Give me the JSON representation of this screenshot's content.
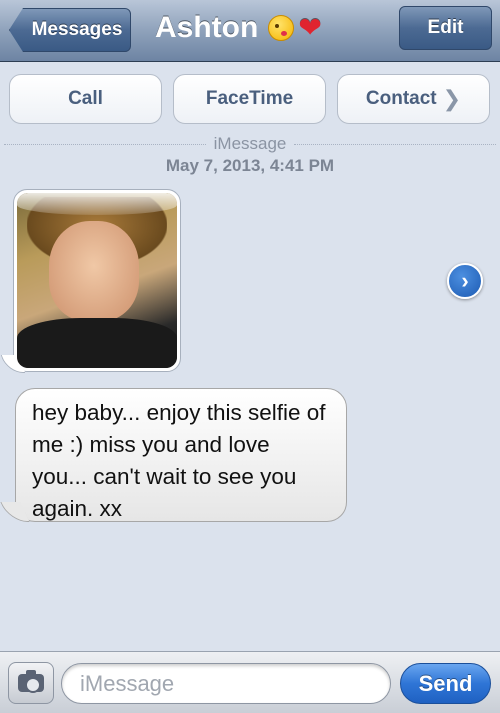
{
  "navbar": {
    "back_label": "Messages",
    "title": "Ashton",
    "edit_label": "Edit",
    "title_emojis": [
      "kiss-emoji",
      "heart-icon"
    ]
  },
  "actions": {
    "call": "Call",
    "facetime": "FaceTime",
    "contact": "Contact"
  },
  "conversation": {
    "service_label": "iMessage",
    "timestamp": "May 7, 2013, 4:41 PM",
    "messages": [
      {
        "type": "photo",
        "description_icon": "selfie-photo"
      },
      {
        "type": "text",
        "text": "hey baby... enjoy this selfie of me :) miss you and love you... can't wait to see you again. xx"
      }
    ]
  },
  "composer": {
    "placeholder": "iMessage",
    "value": "",
    "send_label": "Send"
  },
  "colors": {
    "navbar": "#6d84a3",
    "background": "#dbe2ed",
    "send": "#2f75d6",
    "action_text": "#4a5f7e"
  }
}
